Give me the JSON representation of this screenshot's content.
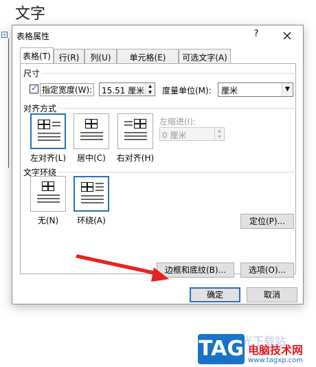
{
  "document": {
    "heading": "文字",
    "marker": "+"
  },
  "dialog": {
    "title": "表格属性",
    "help_label": "?",
    "tabs": [
      {
        "label": "表格(T)"
      },
      {
        "label": "行(R)"
      },
      {
        "label": "列(U)"
      },
      {
        "label": "单元格(E)"
      },
      {
        "label": "可选文字(A)"
      }
    ],
    "size": {
      "section_label": "尺寸",
      "preferred_width_label": "指定宽度(W):",
      "preferred_width_checked": true,
      "preferred_width_value": "15.51 厘米",
      "measure_label": "度量单位(M):",
      "measure_value": "厘米"
    },
    "alignment": {
      "section_label": "对齐方式",
      "options": [
        {
          "label": "左对齐(L)"
        },
        {
          "label": "居中(C)"
        },
        {
          "label": "右对齐(H)"
        }
      ],
      "selected": "左对齐(L)",
      "indent_label": "左缩进(I):",
      "indent_value": "0 厘米"
    },
    "wrapping": {
      "section_label": "文字环绕",
      "options": [
        {
          "label": "无(N)"
        },
        {
          "label": "环绕(A)"
        }
      ],
      "selected": "环绕(A)",
      "position_button": "定位(P)..."
    },
    "borders_button": "边框和底纹(B)...",
    "options_button": "选项(O)...",
    "ok_button": "确定",
    "cancel_button": "取消"
  },
  "watermark": {
    "logo_text": "TAG",
    "top_text": "极光下载站",
    "site_name": "电脑技术网",
    "site_url": "www.tagxp.com"
  },
  "colors": {
    "accent": "#2b6fb8",
    "arrow": "#e8231f",
    "logo_bg": "#1a73c8",
    "site_name": "#e11b22"
  }
}
